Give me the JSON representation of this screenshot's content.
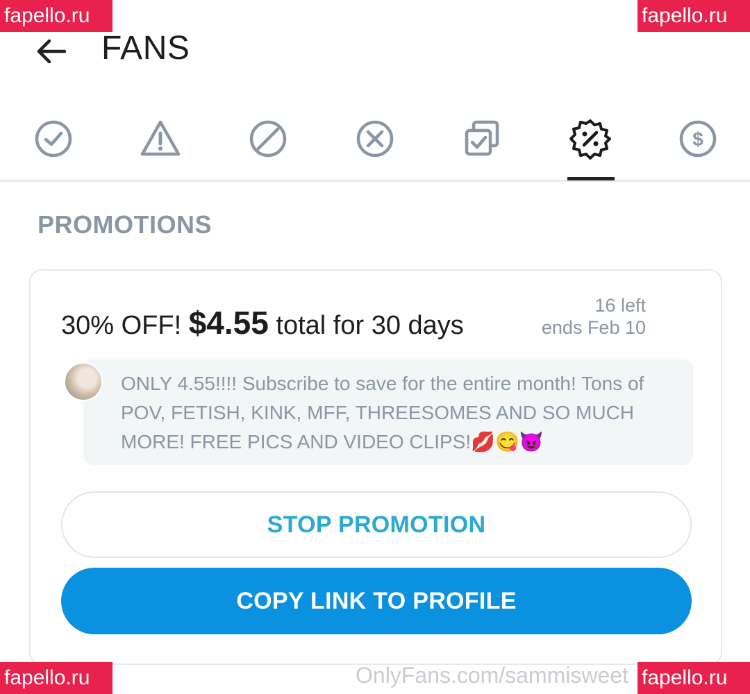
{
  "header": {
    "title": "FANS",
    "back_icon": "arrow-left-icon"
  },
  "tabs": [
    {
      "icon": "check-circle-icon",
      "active": false
    },
    {
      "icon": "warning-triangle-icon",
      "active": false
    },
    {
      "icon": "blocked-icon",
      "active": false
    },
    {
      "icon": "x-circle-icon",
      "active": false
    },
    {
      "icon": "copy-check-icon",
      "active": false
    },
    {
      "icon": "discount-badge-icon",
      "active": true
    },
    {
      "icon": "dollar-circle-icon",
      "active": false
    }
  ],
  "section": {
    "title": "PROMOTIONS"
  },
  "promotion": {
    "discount": "30% OFF!",
    "price": "$4.55",
    "duration": "total for 30 days",
    "left": "16 left",
    "ends": "ends Feb 10",
    "message": "ONLY 4.55!!!! Subscribe to save for the entire month! Tons of POV, FETISH, KINK, MFF, THREESOMES AND SO MUCH MORE! FREE PICS AND VIDEO CLIPS!💋😋😈"
  },
  "buttons": {
    "stop": "STOP PROMOTION",
    "copy": "COPY LINK TO PROFILE"
  },
  "footer": {
    "url": "OnlyFans.com/sammisweet"
  },
  "watermarks": [
    "fapello.ru",
    "fapello.ru",
    "fapello.ru",
    "fapello.ru"
  ],
  "colors": {
    "accent": "#0a91e0",
    "stop_text": "#29a9d4",
    "muted": "#8a96a3",
    "watermark": "#e8224d"
  }
}
